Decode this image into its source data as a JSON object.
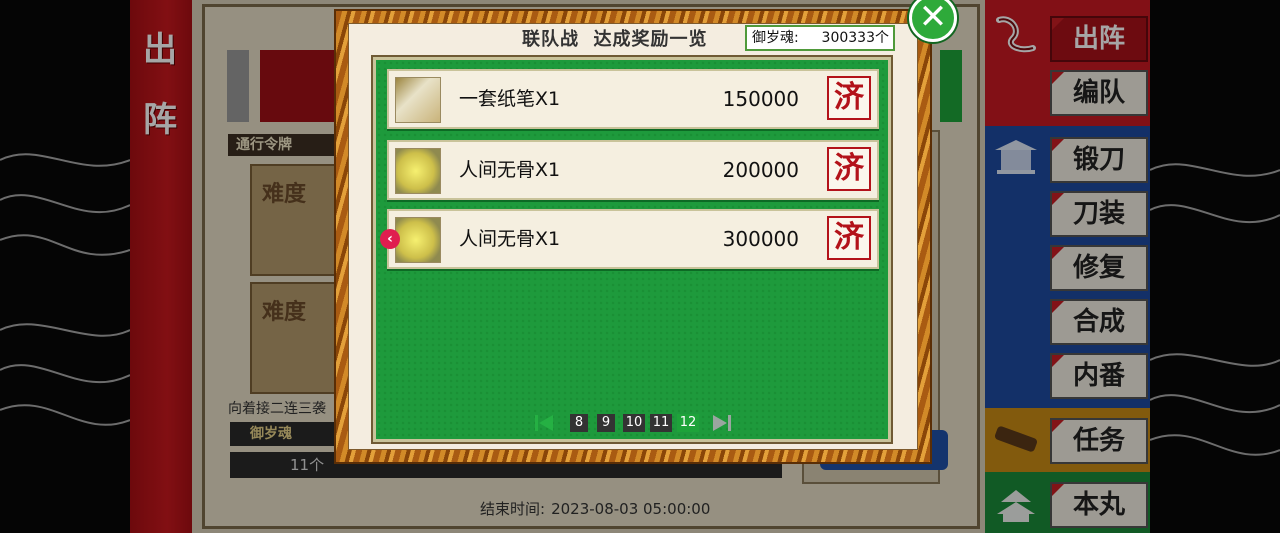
{
  "left_tab": {
    "chars": [
      "出",
      "阵"
    ]
  },
  "background": {
    "pass_label": "通行令牌",
    "difficulty_1": "难度",
    "difficulty_2": "难度",
    "combo_text": "向着接二连三袭",
    "soul_label": "御岁魂",
    "soul_count": "11个",
    "end_time_label": "结束时间:",
    "end_time_value": "2023-08-03 05:00:00"
  },
  "right_menu": {
    "items": [
      {
        "label": "出阵",
        "icon": "ink-brush-icon",
        "active": true
      },
      {
        "label": "编队",
        "icon": "",
        "active": false
      },
      {
        "label": "锻刀",
        "icon": "shrine-icon",
        "active": false
      },
      {
        "label": "刀装",
        "icon": "",
        "active": false
      },
      {
        "label": "修复",
        "icon": "",
        "active": false
      },
      {
        "label": "合成",
        "icon": "",
        "active": false
      },
      {
        "label": "内番",
        "icon": "",
        "active": false
      },
      {
        "label": "任务",
        "icon": "scroll-icon",
        "active": false
      },
      {
        "label": "本丸",
        "icon": "castle-icon",
        "active": false
      }
    ]
  },
  "modal": {
    "title": "联队战  达成奖励一览",
    "soul_label": "御岁魂:",
    "soul_value": "300333个",
    "close_icon": "close-icon",
    "rewards": [
      {
        "name": "一套纸笔X1",
        "points": "150000",
        "status": "济",
        "icon": "paper-set-icon"
      },
      {
        "name": "人间无骨X1",
        "points": "200000",
        "status": "济",
        "icon": "sword-icon"
      },
      {
        "name": "人间无骨X1",
        "points": "300000",
        "status": "济",
        "icon": "sword-icon"
      }
    ],
    "pages": [
      "8",
      "9",
      "10",
      "11",
      "12"
    ],
    "active_page": "12"
  },
  "colors": {
    "accent_green": "#1e9a3c",
    "stamp_red": "#b3121a",
    "menu_red": "#c8181e",
    "menu_blue": "#1a3e8c"
  }
}
